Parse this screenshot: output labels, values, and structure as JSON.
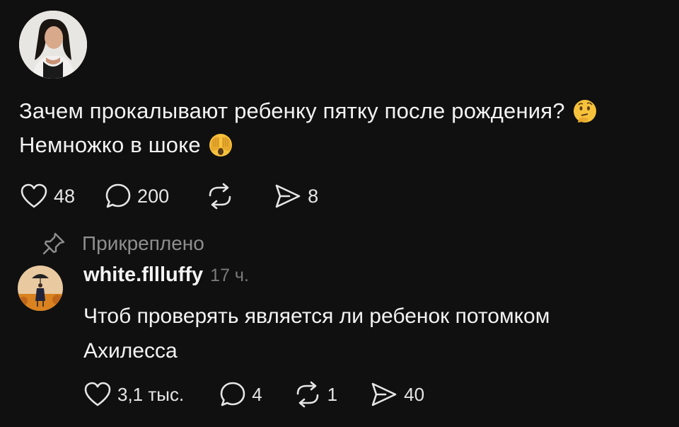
{
  "post": {
    "text_line1": "Зачем прокалывают ребенку пятку после рождения?",
    "text_line1_emoji": "thinking-face",
    "text_line2": "Немножко в шоке",
    "text_line2_emoji": "face-with-hands-over-eyes",
    "actions": {
      "likes": "48",
      "comments": "200",
      "reposts": "",
      "shares": "8"
    }
  },
  "pinned": {
    "label": "Прикреплено"
  },
  "reply": {
    "username": "white.fllluffy",
    "time": "17 ч.",
    "text_line1": "Чтоб проверять является ли ребенок потомком",
    "text_line2": "Ахилесса",
    "actions": {
      "likes": "3,1 тыс.",
      "comments": "4",
      "reposts": "1",
      "shares": "40"
    }
  },
  "icons": [
    "heart-icon",
    "comment-icon",
    "repost-icon",
    "share-icon",
    "pin-icon"
  ],
  "colors": {
    "background": "#101010",
    "text": "#f3f3f3",
    "muted": "#8e8e8e",
    "emoji": "#f7c23b"
  }
}
